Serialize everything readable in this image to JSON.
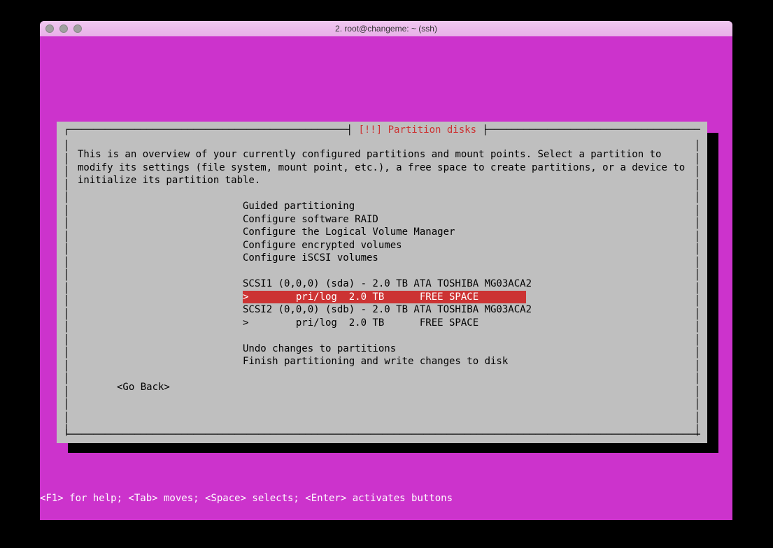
{
  "window": {
    "title": "2. root@changeme: ~ (ssh)"
  },
  "dialog": {
    "title_prefix": "┤ ",
    "title": "[!!] Partition disks",
    "title_suffix": " ├",
    "description": "This is an overview of your currently configured partitions and mount points. Select a partition to modify its settings (file system, mount point, etc.), a free space to create partitions, or a device to initialize its partition table.",
    "menu_top": [
      "Guided partitioning",
      "Configure software RAID",
      "Configure the Logical Volume Manager",
      "Configure encrypted volumes",
      "Configure iSCSI volumes"
    ],
    "disks": [
      {
        "header": "SCSI1 (0,0,0) (sda) - 2.0 TB ATA TOSHIBA MG03ACA2",
        "partition": ">        pri/log  2.0 TB      FREE SPACE        ",
        "selected": true
      },
      {
        "header": "SCSI2 (0,0,0) (sdb) - 2.0 TB ATA TOSHIBA MG03ACA2",
        "partition": ">        pri/log  2.0 TB      FREE SPACE",
        "selected": false
      }
    ],
    "menu_bottom": [
      "Undo changes to partitions",
      "Finish partitioning and write changes to disk"
    ],
    "go_back": "<Go Back>"
  },
  "help_line": "<F1> for help; <Tab> moves; <Space> selects; <Enter> activates buttons"
}
